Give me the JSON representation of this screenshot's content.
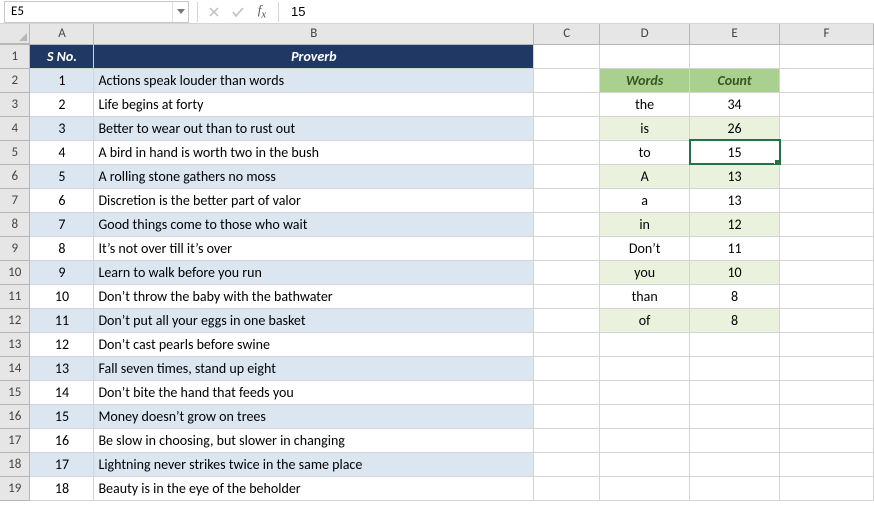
{
  "namebox": "E5",
  "formula": "15",
  "columns": [
    "A",
    "B",
    "C",
    "D",
    "E",
    "F"
  ],
  "rowCount": 19,
  "proverbs": {
    "headers": {
      "sno": "S No.",
      "text": "Proverb"
    },
    "rows": [
      {
        "n": "1",
        "t": "Actions speak louder than words"
      },
      {
        "n": "2",
        "t": "Life begins at forty"
      },
      {
        "n": "3",
        "t": "Better to wear out than to rust out"
      },
      {
        "n": "4",
        "t": "A bird in hand is worth two in the bush"
      },
      {
        "n": "5",
        "t": "A rolling stone gathers no moss"
      },
      {
        "n": "6",
        "t": "Discretion is the better part of valor"
      },
      {
        "n": "7",
        "t": "Good things come to those who wait"
      },
      {
        "n": "8",
        "t": "It’s not over till it’s over"
      },
      {
        "n": "9",
        "t": "Learn to walk before you run"
      },
      {
        "n": "10",
        "t": "Don’t throw the baby with the bathwater"
      },
      {
        "n": "11",
        "t": "Don’t put all your eggs in one basket"
      },
      {
        "n": "12",
        "t": "Don’t cast pearls before swine"
      },
      {
        "n": "13",
        "t": "Fall seven times, stand up eight"
      },
      {
        "n": "14",
        "t": "Don’t bite the hand that feeds you"
      },
      {
        "n": "15",
        "t": "Money doesn’t grow on trees"
      },
      {
        "n": "16",
        "t": "Be slow in choosing, but slower in changing"
      },
      {
        "n": "17",
        "t": "Lightning never strikes twice in the same place"
      },
      {
        "n": "18",
        "t": "Beauty is in the eye of the beholder"
      }
    ]
  },
  "wordcount": {
    "headers": {
      "word": "Words",
      "count": "Count"
    },
    "rows": [
      {
        "w": "the",
        "c": "34"
      },
      {
        "w": "is",
        "c": "26"
      },
      {
        "w": "to",
        "c": "15"
      },
      {
        "w": "A",
        "c": "13"
      },
      {
        "w": "a",
        "c": "13"
      },
      {
        "w": "in",
        "c": "12"
      },
      {
        "w": "Don’t",
        "c": "11"
      },
      {
        "w": "you",
        "c": "10"
      },
      {
        "w": "than",
        "c": "8"
      },
      {
        "w": "of",
        "c": "8"
      }
    ]
  },
  "selectedCell": {
    "row": 5,
    "col": "E"
  }
}
